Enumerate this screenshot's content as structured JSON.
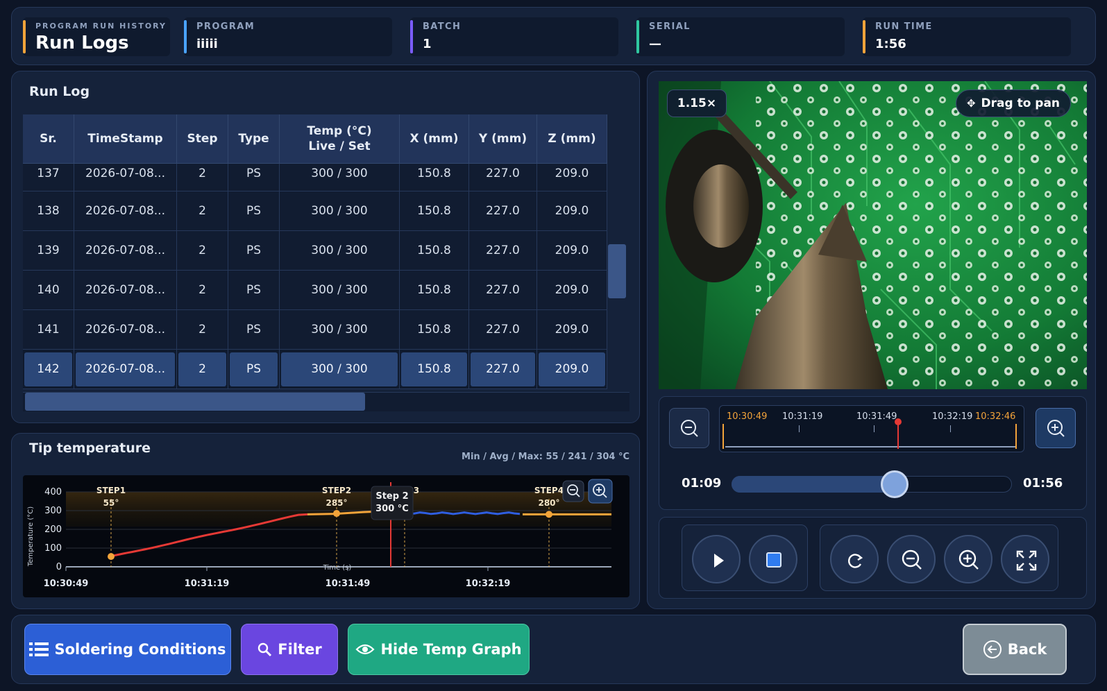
{
  "header": {
    "title_caption": "PROGRAM RUN HISTORY",
    "title": "Run Logs",
    "program_label": "PROGRAM",
    "program": "iiiii",
    "batch_label": "BATCH",
    "batch": "1",
    "serial_label": "SERIAL",
    "serial": "—",
    "runtime_label": "RUN TIME",
    "runtime": "1:56"
  },
  "runlog": {
    "title": "Run Log",
    "columns": [
      "Sr.",
      "TimeStamp",
      "Step",
      "Type",
      "Temp (°C)",
      "Live / Set",
      "X (mm)",
      "Y (mm)",
      "Z (mm)"
    ],
    "rows": [
      [
        "137",
        "2026-07-08...",
        "2",
        "PS",
        "300 / 300",
        "150.8",
        "227.0",
        "209.0"
      ],
      [
        "138",
        "2026-07-08...",
        "2",
        "PS",
        "300 / 300",
        "150.8",
        "227.0",
        "209.0"
      ],
      [
        "139",
        "2026-07-08...",
        "2",
        "PS",
        "300 / 300",
        "150.8",
        "227.0",
        "209.0"
      ],
      [
        "140",
        "2026-07-08...",
        "2",
        "PS",
        "300 / 300",
        "150.8",
        "227.0",
        "209.0"
      ],
      [
        "141",
        "2026-07-08...",
        "2",
        "PS",
        "300 / 300",
        "150.8",
        "227.0",
        "209.0"
      ],
      [
        "142",
        "2026-07-08...",
        "2",
        "PS",
        "300 / 300",
        "150.8",
        "227.0",
        "209.0"
      ]
    ],
    "selected_row": "142"
  },
  "temp": {
    "title": "Tip temperature",
    "stats": "Min / Avg / Max:  55  /  241  /  304 °C",
    "tooltip_line1": "Step 2",
    "tooltip_line2": "300 °C"
  },
  "chart_data": {
    "type": "line",
    "ylabel": "Temperature (°C)",
    "xlabel": "Time (s)",
    "ylim": [
      0,
      400
    ],
    "yticks": [
      "400",
      "300",
      "200",
      "100",
      "0"
    ],
    "xticks": [
      "10:30:49",
      "10:31:19",
      "10:31:49",
      "10:32:19"
    ],
    "steps": [
      {
        "name": "STEP1",
        "value": "55°"
      },
      {
        "name": "STEP2",
        "value": "285°"
      },
      {
        "name": "STEP3",
        "value": "°"
      },
      {
        "name": "STEP4",
        "value": "280°"
      }
    ]
  },
  "video": {
    "zoom": "1.15×",
    "pan_hint": "Drag to pan",
    "timeline_labels": [
      "10:30:49",
      "10:31:19",
      "10:31:49",
      "10:32:19",
      "10:32:46"
    ],
    "current_time": "01:09",
    "total_time": "01:56",
    "progress": 0.595,
    "accent": "#f3a43a"
  },
  "footer": {
    "conditions": "Soldering Conditions",
    "filter": "Filter",
    "hide_graph": "Hide Temp Graph",
    "back": "Back"
  }
}
